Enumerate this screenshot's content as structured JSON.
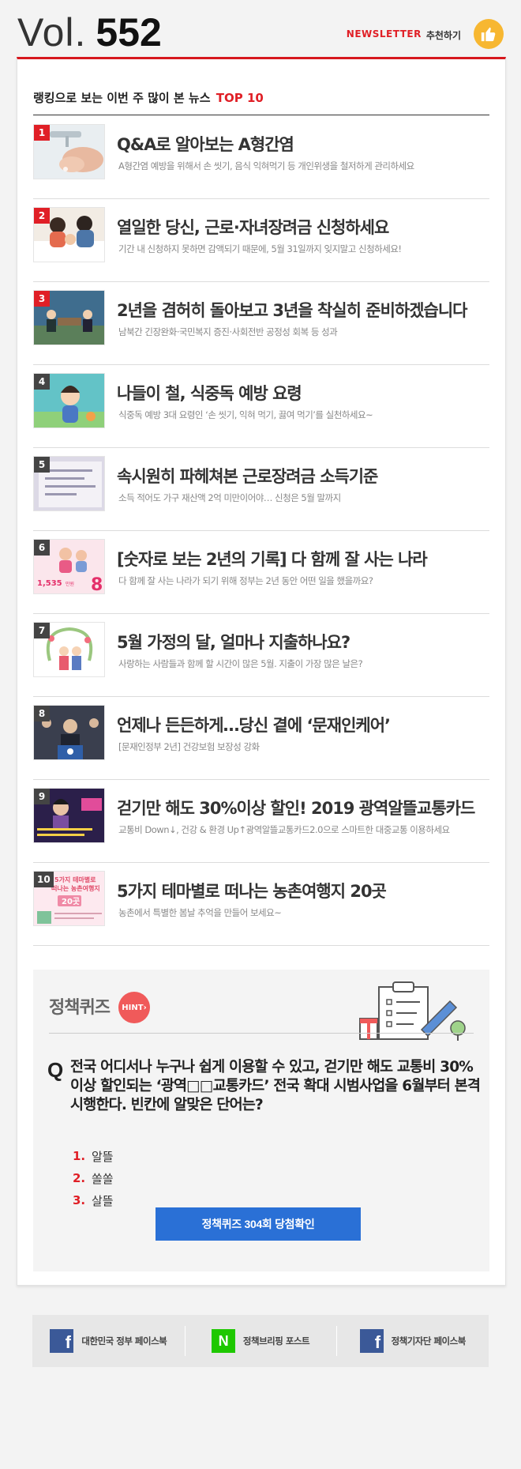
{
  "header": {
    "vol_label": "Vol.",
    "vol_number": "552",
    "newsletter": "NEWSLETTER",
    "recommend": "추천하기"
  },
  "section": {
    "title": "랭킹으로 보는 이번 주 많이 본 뉴스",
    "title_highlight": "TOP 10"
  },
  "news": [
    {
      "rank": "1",
      "title": "Q&A로 알아보는 A형간염",
      "desc": "A형간염 예방을 위해서 손 씻기, 음식 익혀먹기 등 개인위생을 철저하게 관리하세요"
    },
    {
      "rank": "2",
      "title": "열일한 당신, 근로·자녀장려금 신청하세요",
      "desc": "기간 내 신청하지 못하면 감액되기 때문에, 5월 31일까지 잊지말고 신청하세요!"
    },
    {
      "rank": "3",
      "title": "2년을 겸허히 돌아보고 3년을 착실히 준비하겠습니다",
      "desc": "남북간 긴장완화·국민복지 증진·사회전반 공정성 회복 등 성과"
    },
    {
      "rank": "4",
      "title": "나들이 철, 식중독 예방 요령",
      "desc": "식중독 예방 3대 요령인 ‘손 씻기, 익혀 먹기, 끓여 먹기’를 실천하세요~"
    },
    {
      "rank": "5",
      "title": "속시원히 파헤쳐본 근로장려금 소득기준",
      "desc": "소득 적어도 가구 재산액 2억 미만이어야… 신청은 5월 말까지"
    },
    {
      "rank": "6",
      "title": "[숫자로 보는 2년의 기록] 다 함께 잘 사는 나라",
      "desc": "다 함께 잘 사는 나라가 되기 위해 정부는 2년 동안 어떤 일을 했을까요?"
    },
    {
      "rank": "7",
      "title": "5월 가정의 달, 얼마나 지출하나요?",
      "desc": "사랑하는 사람들과 함께 할 시간이 많은 5월. 지출이 가장 많은 날은?"
    },
    {
      "rank": "8",
      "title": "언제나 든든하게…당신 곁에 ‘문재인케어’",
      "desc": "[문재인정부 2년] 건강보험 보장성 강화"
    },
    {
      "rank": "9",
      "title": "걷기만 해도 30%이상 할인! 2019 광역알뜰교통카드",
      "desc": "교통비 Down↓, 건강 & 환경 Up↑광역알뜰교통카드2.0으로 스마트한 대중교통 이용하세요"
    },
    {
      "rank": "10",
      "title": "5가지 테마별로 떠나는 농촌여행지 20곳",
      "desc": "농촌에서 특별한 봄날 추억을 만들어 보세요~"
    }
  ],
  "thumb_text": {
    "t6_number": "1,535",
    "t6_unit": "만원",
    "t6_big": "8",
    "t10_line1": "5가지 테마별로",
    "t10_line2": "떠나는 농촌여행지",
    "t10_count": "20곳"
  },
  "quiz": {
    "title": "정책퀴즈",
    "hint": "HINT",
    "q_mark": "Q",
    "question": "전국 어디서나 누구나 쉽게 이용할 수 있고, 걷기만 해도 교통비 30% 이상 할인되는 ‘광역□□교통카드’ 전국 확대 시범사업을 6월부터 본격 시행한다. 빈칸에 알맞은 단어는?",
    "options": [
      {
        "num": "1.",
        "label": "알뜰"
      },
      {
        "num": "2.",
        "label": "쏠쏠"
      },
      {
        "num": "3.",
        "label": "살뜰"
      }
    ],
    "button": "정책퀴즈 304회 당첨확인"
  },
  "footer": {
    "links": [
      {
        "icon": "f",
        "label": "대한민국 정부 페이스북"
      },
      {
        "icon": "N",
        "label": "정책브리핑 포스트"
      },
      {
        "icon": "f",
        "label": "정책기자단 페이스북"
      }
    ]
  },
  "colors": {
    "accent_red": "#e01f26",
    "button_blue": "#2a70d6",
    "facebook": "#3b5998",
    "naver": "#1ec800",
    "hint": "#f05a5a"
  }
}
